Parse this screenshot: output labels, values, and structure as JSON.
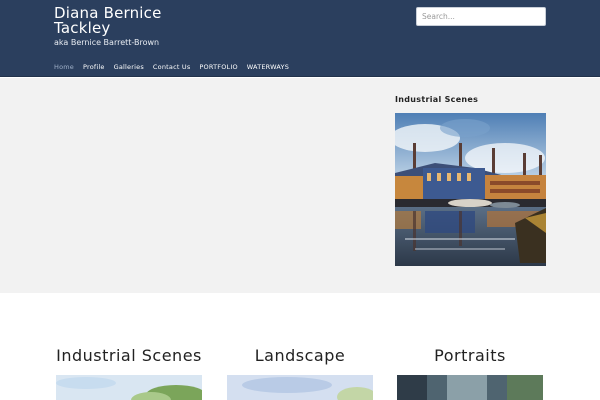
{
  "header": {
    "title_line1": "Diana Bernice",
    "title_line2": "Tackley",
    "tagline": "aka Bernice Barrett-Brown",
    "search_placeholder": "Search..."
  },
  "nav": [
    {
      "label": "Home",
      "active": true
    },
    {
      "label": "Profile"
    },
    {
      "label": "Galleries"
    },
    {
      "label": "Contact Us"
    },
    {
      "label": "PORTFOLIO"
    },
    {
      "label": "WATERWAYS"
    }
  ],
  "sidebar_widget": {
    "title": "Industrial Scenes"
  },
  "galleries": [
    {
      "title": "Industrial Scenes"
    },
    {
      "title": "Landscape"
    },
    {
      "title": "Portraits"
    }
  ]
}
